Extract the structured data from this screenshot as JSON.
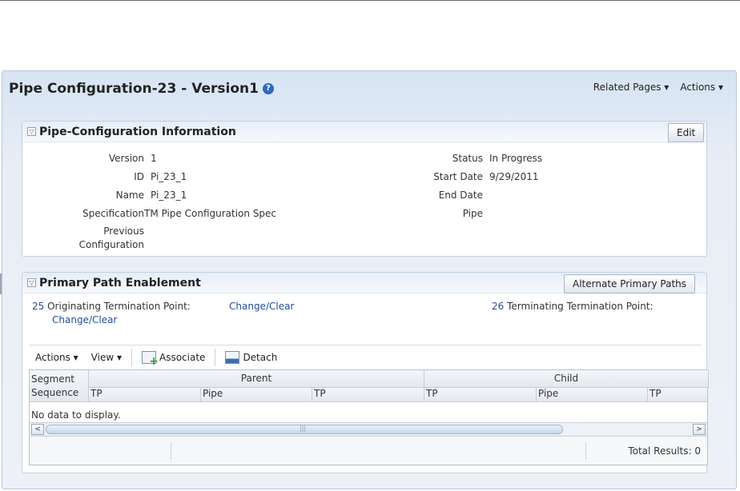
{
  "page": {
    "title": "Pipe Configuration-23 - Version1",
    "help_icon": "?",
    "menus": [
      "Related Pages ▾",
      "Actions ▾"
    ]
  },
  "info_panel": {
    "title": "Pipe-Configuration Information",
    "edit_label": "Edit",
    "left_fields": [
      {
        "label": "Version",
        "value": "1"
      },
      {
        "label": "ID",
        "value": "Pi_23_1"
      },
      {
        "label": "Name",
        "value": "Pi_23_1"
      },
      {
        "label": "Specification",
        "value": "TM Pipe Configuration Spec"
      },
      {
        "label": "Previous\nConfiguration",
        "value": ""
      }
    ],
    "right_fields": [
      {
        "label": "Status",
        "value": "In Progress"
      },
      {
        "label": "Start Date",
        "value": "9/29/2011"
      },
      {
        "label": "End Date",
        "value": ""
      },
      {
        "label": "Pipe",
        "value": ""
      }
    ]
  },
  "path_panel": {
    "title": "Primary Path Enablement",
    "alt_button": "Alternate Primary Paths",
    "orig_number": "25",
    "orig_label": "Originating Termination Point:",
    "orig_change": "Change/Clear",
    "orig_change2": "Change/Clear",
    "term_number": "26",
    "term_label": "Terminating Termination Point:",
    "toolbar": {
      "actions": "Actions ▾",
      "view": "View ▾",
      "associate": "Associate",
      "detach": "Detach"
    },
    "table": {
      "segment_header": "Segment\nSequence",
      "parent_header": "Parent",
      "child_header": "Child",
      "sub_headers": [
        "TP",
        "Pipe",
        "TP",
        "TP",
        "Pipe",
        "TP"
      ],
      "empty_text": "No data to display.",
      "scroll_left": "<",
      "scroll_right": ">",
      "scroll_grip": "|||",
      "total_results": "Total Results: 0"
    }
  }
}
